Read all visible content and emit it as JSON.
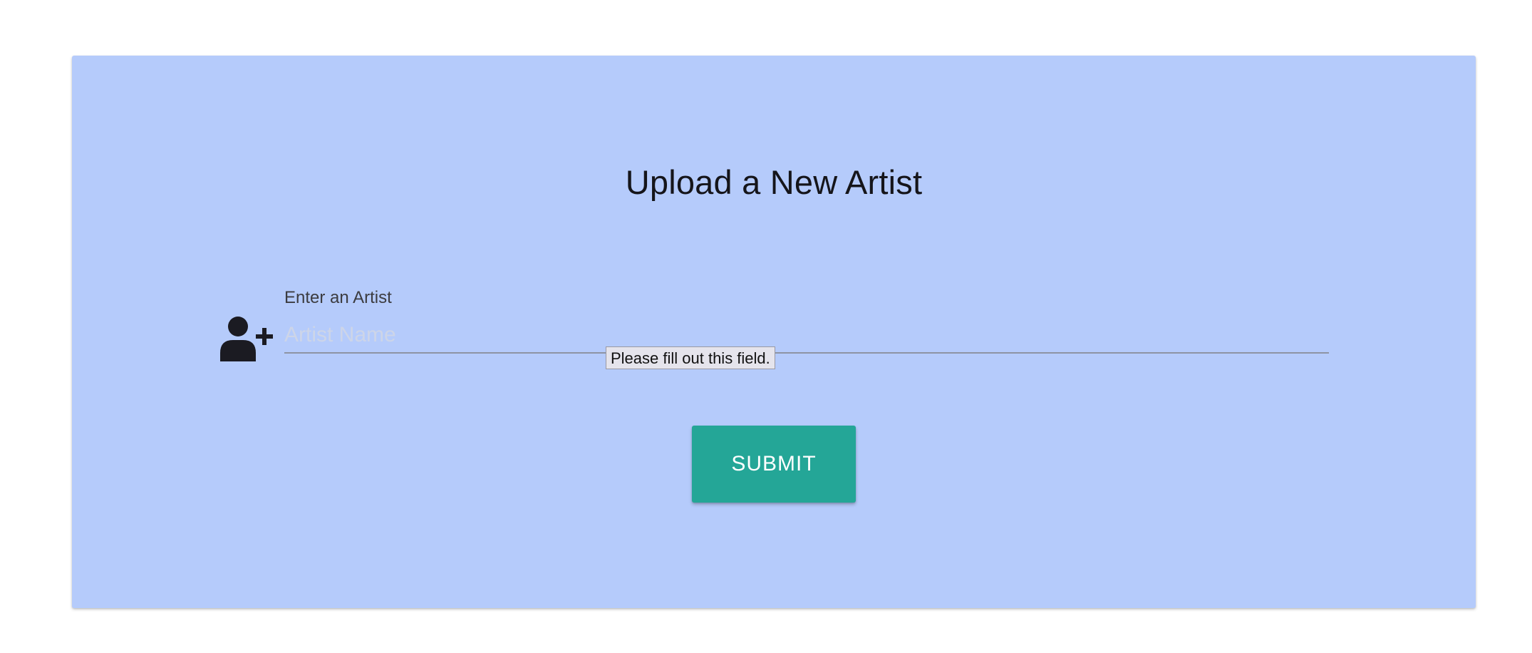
{
  "form": {
    "title": "Upload a New Artist",
    "field_label": "Enter an Artist",
    "field_placeholder": "Artist Name",
    "field_value": "",
    "validation_tooltip": "Please fill out this field.",
    "submit_label": "SUBMIT",
    "icon": "add-user-icon"
  },
  "colors": {
    "card_background": "#b5cbfb",
    "submit_button": "#24a697",
    "title_text": "#15151a"
  }
}
